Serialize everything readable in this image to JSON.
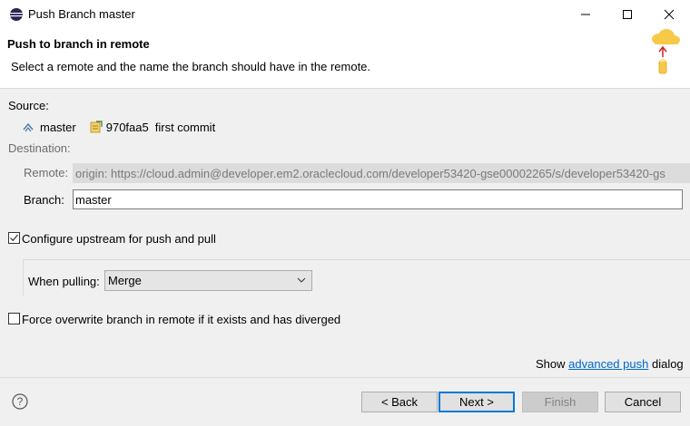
{
  "window": {
    "title": "Push Branch master"
  },
  "header": {
    "title": "Push to branch in remote",
    "description": "Select a remote and the name the branch should have in the remote."
  },
  "source": {
    "label": "Source:",
    "branch": "master",
    "commit_id": "970faa5",
    "commit_message": "first commit"
  },
  "destination": {
    "label": "Destination:",
    "remote_label": "Remote:",
    "remote_value": "origin: https://cloud.admin@developer.em2.oraclecloud.com/developer53420-gse00002265/s/developer53420-gs",
    "branch_label": "Branch:",
    "branch_value": "master"
  },
  "upstream": {
    "configure_label": "Configure upstream for push and pull",
    "configure_checked": true,
    "when_pulling_label": "When pulling:",
    "when_pulling_value": "Merge"
  },
  "force": {
    "label": "Force overwrite branch in remote if it exists and has diverged",
    "checked": false
  },
  "advanced": {
    "prefix": "Show",
    "link": "advanced push",
    "suffix": "dialog"
  },
  "buttons": {
    "back": "< Back",
    "next": "Next >",
    "finish": "Finish",
    "cancel": "Cancel"
  },
  "colors": {
    "accent": "#0078d7",
    "link": "#0066cc",
    "disabled_field": "#dcdcdc"
  }
}
